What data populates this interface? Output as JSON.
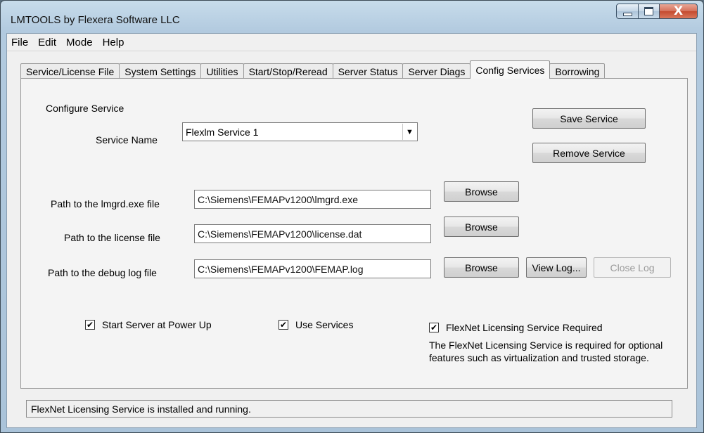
{
  "window": {
    "title": "LMTOOLS by Flexera Software LLC",
    "close_glyph": "X"
  },
  "menu": [
    "File",
    "Edit",
    "Mode",
    "Help"
  ],
  "tabs": [
    {
      "label": "Service/License File",
      "active": false
    },
    {
      "label": "System Settings",
      "active": false
    },
    {
      "label": "Utilities",
      "active": false
    },
    {
      "label": "Start/Stop/Reread",
      "active": false
    },
    {
      "label": "Server Status",
      "active": false
    },
    {
      "label": "Server Diags",
      "active": false
    },
    {
      "label": "Config Services",
      "active": true
    },
    {
      "label": "Borrowing",
      "active": false
    }
  ],
  "config": {
    "section_title": "Configure Service",
    "service_name_label": "Service Name",
    "service_name_value": "Flexlm Service 1",
    "dropdown_arrow": "▼",
    "save_button": "Save Service",
    "remove_button": "Remove Service",
    "lmgrd_label": "Path to the lmgrd.exe file",
    "lmgrd_value": "C:\\Siemens\\FEMAPv1200\\lmgrd.exe",
    "license_label": "Path to the license file",
    "license_value": "C:\\Siemens\\FEMAPv1200\\license.dat",
    "debug_label": "Path to the debug log file",
    "debug_value": "C:\\Siemens\\FEMAPv1200\\FEMAP.log",
    "browse_label": "Browse",
    "view_log_label": "View Log...",
    "close_log_label": "Close Log",
    "close_log_enabled": false,
    "start_at_powerup_label": "Start Server at Power Up",
    "start_at_powerup_checked": true,
    "use_services_label": "Use Services",
    "use_services_checked": true,
    "flexnet_required_label": "FlexNet Licensing Service Required",
    "flexnet_required_checked": true,
    "check_mark": "✔",
    "flexnet_note": "The FlexNet Licensing Service is required for optional features such as virtualization and trusted storage."
  },
  "status": {
    "text": "FlexNet Licensing Service is installed and running."
  }
}
